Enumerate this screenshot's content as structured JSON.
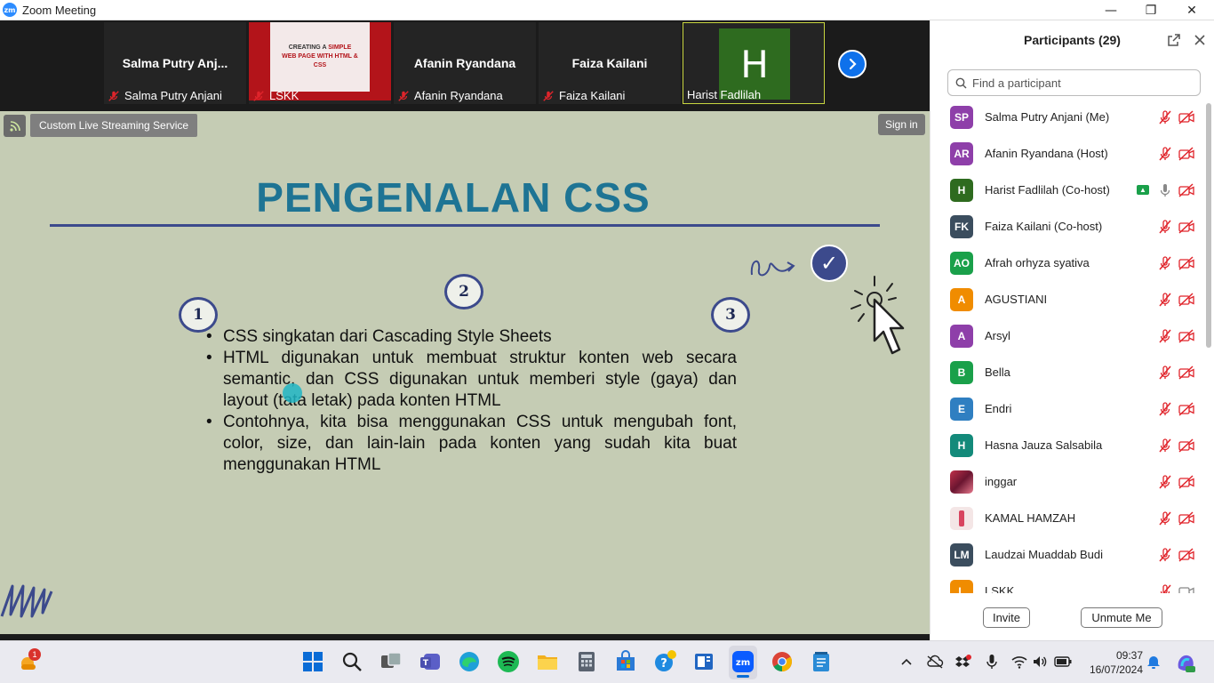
{
  "window": {
    "title": "Zoom Meeting",
    "logo_text": "zm",
    "minimize": "—",
    "maximize": "❐",
    "close": "✕"
  },
  "video_strip": {
    "tiles": [
      {
        "display_name": "Salma  Putry  Anj...",
        "label": "Salma Putry Anjani"
      },
      {
        "label": "LSKK",
        "slide_title_top": "CREATING A",
        "slide_title_highlight": "SIMPLE",
        "slide_title_bottom": "WEB PAGE WITH HTML & CSS"
      },
      {
        "display_name": "Afanin Ryandana",
        "label": "Afanin Ryandana"
      },
      {
        "display_name": "Faiza Kailani",
        "label": "Faiza Kailani"
      },
      {
        "avatar_letter": "H",
        "label": "Harist Fadlilah"
      }
    ]
  },
  "share": {
    "streaming_badge": "Custom Live Streaming Service",
    "signin": "Sign in",
    "slide": {
      "title": "PENGENALAN CSS",
      "numbers": [
        "1",
        "2",
        "3"
      ],
      "bullets": [
        "CSS singkatan dari Cascading Style Sheets",
        "HTML digunakan untuk membuat struktur konten web secara semantic, dan CSS digunakan untuk memberi style (gaya) dan layout (tata letak) pada konten HTML",
        "Contohnya, kita bisa menggunakan CSS untuk mengubah font, color, size, dan lain-lain pada konten yang sudah kita buat menggunakan HTML"
      ],
      "check": "✓"
    }
  },
  "participants": {
    "title": "Participants (29)",
    "search_placeholder": "Find a participant",
    "list": [
      {
        "initials": "SP",
        "name": "Salma Putry Anjani (Me)",
        "color": "#8e3fa9"
      },
      {
        "initials": "AR",
        "name": "Afanin Ryandana (Host)",
        "color": "#8e3fa9"
      },
      {
        "initials": "H",
        "name": "Harist Fadlilah (Co-host)",
        "color": "#2e6b1f"
      },
      {
        "initials": "FK",
        "name": "Faiza Kailani (Co-host)",
        "color": "#3b4d5e"
      },
      {
        "initials": "AO",
        "name": "Afrah orhyza syativa",
        "color": "#1aa04a"
      },
      {
        "initials": "A",
        "name": "AGUSTIANI",
        "color": "#f08c00"
      },
      {
        "initials": "A",
        "name": "Arsyl",
        "color": "#8e3fa9"
      },
      {
        "initials": "B",
        "name": "Bella",
        "color": "#1aa04a"
      },
      {
        "initials": "E",
        "name": "Endri",
        "color": "#2f7fc1"
      },
      {
        "initials": "H",
        "name": "Hasna Jauza Salsabila",
        "color": "#138a7a"
      },
      {
        "initials": "",
        "name": "inggar",
        "color": "#c0304a"
      },
      {
        "initials": "",
        "name": "KAMAL HAMZAH",
        "color": "#f2e2e2"
      },
      {
        "initials": "LM",
        "name": "Laudzai Muaddab Budi",
        "color": "#3b4d5e"
      },
      {
        "initials": "L",
        "name": "LSKK",
        "color": "#f08c00"
      }
    ],
    "invite": "Invite",
    "unmute_me": "Unmute Me"
  },
  "taskbar": {
    "weather_badge": "1",
    "time": "09:37",
    "date": "16/07/2024"
  },
  "colors": {
    "accent": "#0e71eb",
    "slide_bg": "#c5ccb4",
    "slide_title": "#1e7494",
    "slide_ink": "#3c4a8c",
    "muted_red": "#e0242b"
  }
}
